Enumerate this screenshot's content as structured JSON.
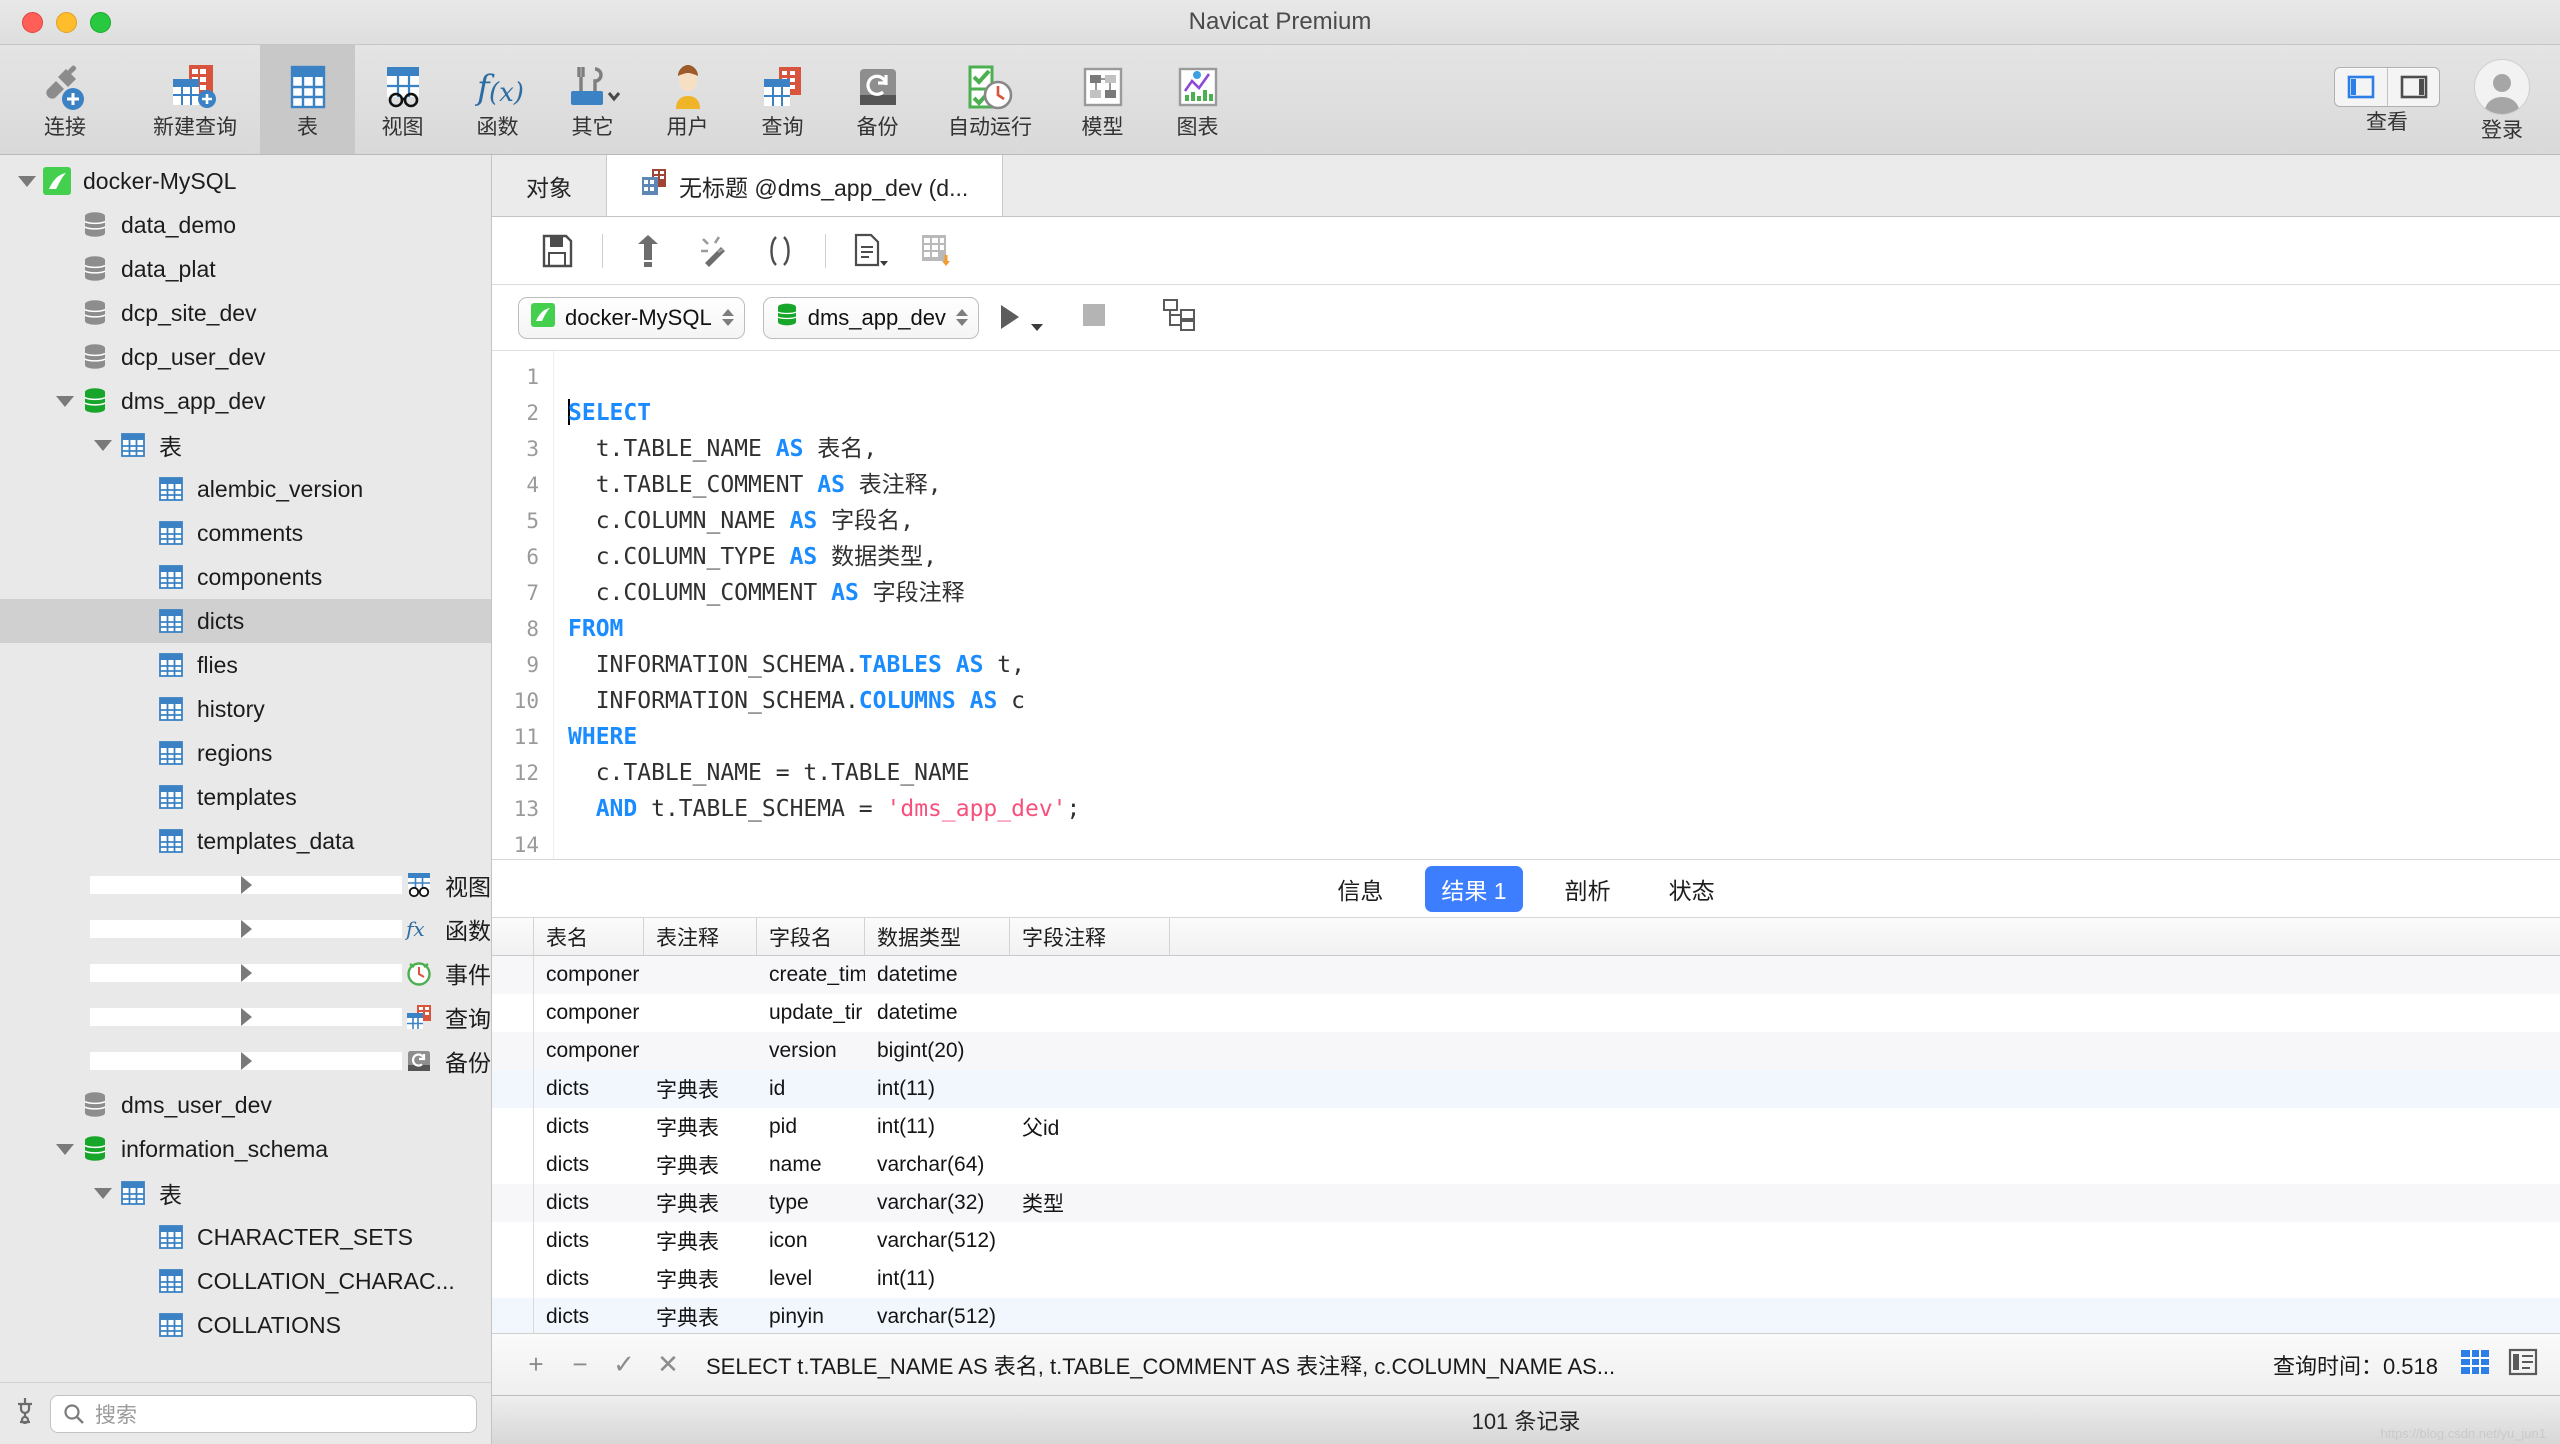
{
  "window": {
    "title": "Navicat Premium"
  },
  "toolbar": {
    "items": [
      {
        "label": "连接",
        "icon": "connect-icon"
      },
      {
        "label": "新建查询",
        "icon": "new-query-icon"
      },
      {
        "label": "表",
        "icon": "table-icon"
      },
      {
        "label": "视图",
        "icon": "view-icon"
      },
      {
        "label": "函数",
        "icon": "function-icon"
      },
      {
        "label": "其它",
        "icon": "other-tools-icon"
      },
      {
        "label": "用户",
        "icon": "user-icon"
      },
      {
        "label": "查询",
        "icon": "query-icon"
      },
      {
        "label": "备份",
        "icon": "backup-icon"
      },
      {
        "label": "自动运行",
        "icon": "automation-icon"
      },
      {
        "label": "模型",
        "icon": "model-icon"
      },
      {
        "label": "图表",
        "icon": "chart-icon"
      }
    ],
    "view_label": "查看",
    "login_label": "登录"
  },
  "sidebar": {
    "search_placeholder": "搜索",
    "tree": [
      {
        "label": "docker-MySQL",
        "icon": "navicat-connection-icon",
        "indent": 0,
        "twisty": "down",
        "selected": false
      },
      {
        "label": "data_demo",
        "icon": "database-gray-icon",
        "indent": 1,
        "twisty": "none",
        "selected": false
      },
      {
        "label": "data_plat",
        "icon": "database-gray-icon",
        "indent": 1,
        "twisty": "none",
        "selected": false
      },
      {
        "label": "dcp_site_dev",
        "icon": "database-gray-icon",
        "indent": 1,
        "twisty": "none",
        "selected": false
      },
      {
        "label": "dcp_user_dev",
        "icon": "database-gray-icon",
        "indent": 1,
        "twisty": "none",
        "selected": false
      },
      {
        "label": "dms_app_dev",
        "icon": "database-green-icon",
        "indent": 1,
        "twisty": "down",
        "selected": false
      },
      {
        "label": "表",
        "icon": "table-folder-icon",
        "indent": 2,
        "twisty": "down",
        "selected": false
      },
      {
        "label": "alembic_version",
        "icon": "table-icon",
        "indent": 3,
        "twisty": "none",
        "selected": false
      },
      {
        "label": "comments",
        "icon": "table-icon",
        "indent": 3,
        "twisty": "none",
        "selected": false
      },
      {
        "label": "components",
        "icon": "table-icon",
        "indent": 3,
        "twisty": "none",
        "selected": false
      },
      {
        "label": "dicts",
        "icon": "table-icon",
        "indent": 3,
        "twisty": "none",
        "selected": true
      },
      {
        "label": "flies",
        "icon": "table-icon",
        "indent": 3,
        "twisty": "none",
        "selected": false
      },
      {
        "label": "history",
        "icon": "table-icon",
        "indent": 3,
        "twisty": "none",
        "selected": false
      },
      {
        "label": "regions",
        "icon": "table-icon",
        "indent": 3,
        "twisty": "none",
        "selected": false
      },
      {
        "label": "templates",
        "icon": "table-icon",
        "indent": 3,
        "twisty": "none",
        "selected": false
      },
      {
        "label": "templates_data",
        "icon": "table-icon",
        "indent": 3,
        "twisty": "none",
        "selected": false
      },
      {
        "label": "视图",
        "icon": "view-folder-icon",
        "indent": 2,
        "twisty": "right",
        "selected": false
      },
      {
        "label": "函数",
        "icon": "function-folder-icon",
        "indent": 2,
        "twisty": "right",
        "selected": false
      },
      {
        "label": "事件",
        "icon": "event-folder-icon",
        "indent": 2,
        "twisty": "right",
        "selected": false
      },
      {
        "label": "查询",
        "icon": "query-folder-icon",
        "indent": 2,
        "twisty": "right",
        "selected": false
      },
      {
        "label": "备份",
        "icon": "backup-folder-icon",
        "indent": 2,
        "twisty": "right",
        "selected": false
      },
      {
        "label": "dms_user_dev",
        "icon": "database-gray-icon",
        "indent": 1,
        "twisty": "none",
        "selected": false
      },
      {
        "label": "information_schema",
        "icon": "database-green-icon",
        "indent": 1,
        "twisty": "down",
        "selected": false
      },
      {
        "label": "表",
        "icon": "table-folder-icon",
        "indent": 2,
        "twisty": "down",
        "selected": false
      },
      {
        "label": "CHARACTER_SETS",
        "icon": "table-icon",
        "indent": 3,
        "twisty": "none",
        "selected": false
      },
      {
        "label": "COLLATION_CHARAC...",
        "icon": "table-icon",
        "indent": 3,
        "twisty": "none",
        "selected": false
      },
      {
        "label": "COLLATIONS",
        "icon": "table-icon",
        "indent": 3,
        "twisty": "none",
        "selected": false
      }
    ]
  },
  "tabs": [
    {
      "label": "对象",
      "icon": "none",
      "active": false
    },
    {
      "label": "无标题 @dms_app_dev (d...",
      "icon": "query-doc-icon",
      "active": true
    }
  ],
  "editor_toolbar": {
    "buttons": [
      {
        "name": "save-icon"
      },
      {
        "name": "beautify-icon"
      },
      {
        "name": "magic-wand-icon"
      },
      {
        "name": "parentheses-icon"
      },
      {
        "name": "explain-doc-icon"
      },
      {
        "name": "export-table-icon"
      }
    ]
  },
  "connection_bar": {
    "connection": "docker-MySQL",
    "database": "dms_app_dev",
    "run_icon": "run-icon",
    "stop_icon": "stop-icon",
    "plan_icon": "explain-plan-icon"
  },
  "sql": {
    "lines": [
      {
        "no": "1",
        "text": ""
      },
      {
        "no": "2",
        "text": "SELECT",
        "cursor": true
      },
      {
        "no": "3",
        "text": "  t.TABLE_NAME AS 表名,"
      },
      {
        "no": "4",
        "text": "  t.TABLE_COMMENT AS 表注释,"
      },
      {
        "no": "5",
        "text": "  c.COLUMN_NAME AS 字段名,"
      },
      {
        "no": "6",
        "text": "  c.COLUMN_TYPE AS 数据类型,"
      },
      {
        "no": "7",
        "text": "  c.COLUMN_COMMENT AS 字段注释"
      },
      {
        "no": "8",
        "text": "FROM"
      },
      {
        "no": "9",
        "text": "  INFORMATION_SCHEMA.TABLES AS t,"
      },
      {
        "no": "10",
        "text": "  INFORMATION_SCHEMA.COLUMNS AS c"
      },
      {
        "no": "11",
        "text": "WHERE"
      },
      {
        "no": "12",
        "text": "  c.TABLE_NAME = t.TABLE_NAME"
      },
      {
        "no": "13",
        "text": "  AND t.TABLE_SCHEMA = 'dms_app_dev';"
      },
      {
        "no": "14",
        "text": ""
      }
    ]
  },
  "result_tabs": [
    {
      "label": "信息",
      "active": false
    },
    {
      "label": "结果 1",
      "active": true
    },
    {
      "label": "剖析",
      "active": false
    },
    {
      "label": "状态",
      "active": false
    }
  ],
  "grid": {
    "columns": [
      "表名",
      "表注释",
      "字段名",
      "数据类型",
      "字段注释"
    ],
    "rows": [
      [
        "componer",
        "",
        "create_tim",
        "datetime",
        ""
      ],
      [
        "componer",
        "",
        "update_tir",
        "datetime",
        ""
      ],
      [
        "componer",
        "",
        "version",
        "bigint(20)",
        ""
      ],
      [
        "dicts",
        "字典表",
        "id",
        "int(11)",
        ""
      ],
      [
        "dicts",
        "字典表",
        "pid",
        "int(11)",
        "父id"
      ],
      [
        "dicts",
        "字典表",
        "name",
        "varchar(64)",
        ""
      ],
      [
        "dicts",
        "字典表",
        "type",
        "varchar(32)",
        "类型"
      ],
      [
        "dicts",
        "字典表",
        "icon",
        "varchar(512)",
        ""
      ],
      [
        "dicts",
        "字典表",
        "level",
        "int(11)",
        ""
      ],
      [
        "dicts",
        "字典表",
        "pinyin",
        "varchar(512)",
        ""
      ]
    ]
  },
  "sql_bar": {
    "add_icon": "+",
    "remove_icon": "−",
    "confirm_icon": "✓",
    "cancel_icon": "✕",
    "statement": "SELECT  t.TABLE_NAME AS 表名,     t.TABLE_COMMENT AS 表注释, c.COLUMN_NAME AS...",
    "query_time": "查询时间：0.518",
    "grid_view_icon": "grid-view-icon",
    "form_view_icon": "form-view-icon"
  },
  "statusbar": {
    "record_count": "101 条记录",
    "watermark": "https://blog.csdn.net/yu_jun1"
  },
  "colors": {
    "accent": "#3d7eff",
    "keyword": "#1a8cff",
    "string": "#f8507d",
    "sidebar_bg": "#e9e9e9",
    "toolbar_bg": "#dcdcdc"
  }
}
